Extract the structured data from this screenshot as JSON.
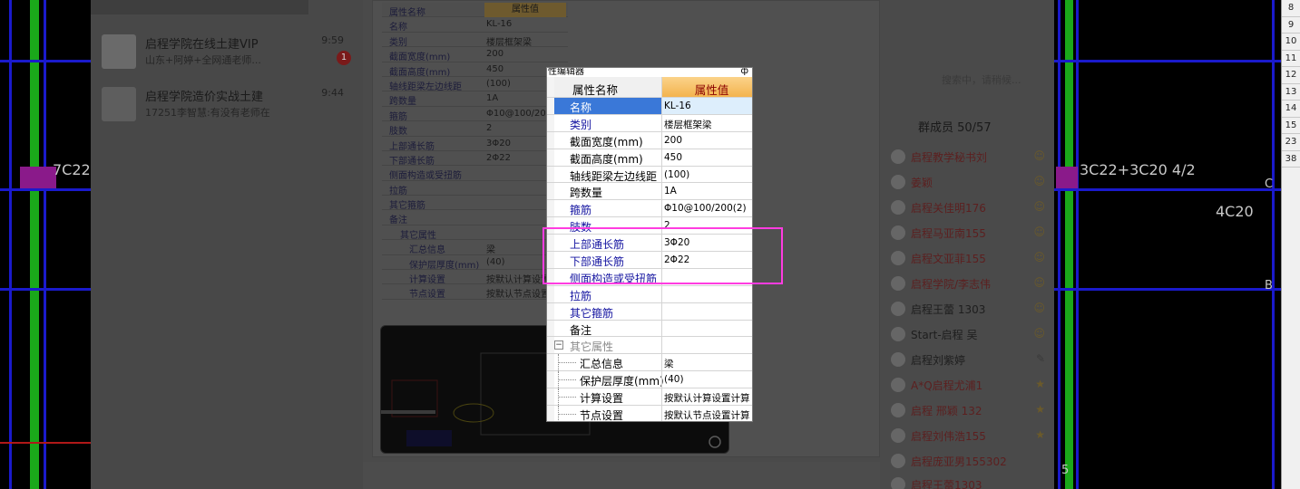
{
  "cad_left": {
    "label": "7C22"
  },
  "cad_right": {
    "label_top": "3C22+3C20 4/2",
    "label_mid": "4C20",
    "marker_c": "C",
    "marker_b": "B",
    "marker_5": "5"
  },
  "ruler": [
    "8",
    "9",
    "10",
    "11",
    "12",
    "13",
    "14",
    "15",
    "23",
    "38"
  ],
  "conversations": [
    {
      "name": "启程学院在线土建VIP",
      "time": "9:59",
      "preview": "山东+阿婷+全网通老师...",
      "badge": "1"
    },
    {
      "name": "启程学院造价实战土建",
      "time": "9:44",
      "preview": "17251李智慧:有没有老师在"
    }
  ],
  "background_table": {
    "header": {
      "key": "属性名称",
      "value": "属性值"
    },
    "rows": [
      {
        "key": "名称",
        "value": "KL-16"
      },
      {
        "key": "类别",
        "value": "楼层框架梁"
      },
      {
        "key": "截面宽度(mm)",
        "value": "200"
      },
      {
        "key": "截面高度(mm)",
        "value": "450"
      },
      {
        "key": "轴线距梁左边线距",
        "value": "(100)"
      },
      {
        "key": "跨数量",
        "value": "1A"
      },
      {
        "key": "箍筋",
        "value": "Φ10@100/200(2)"
      },
      {
        "key": "肢数",
        "value": "2"
      },
      {
        "key": "上部通长筋",
        "value": "3Φ20"
      },
      {
        "key": "下部通长筋",
        "value": "2Φ22"
      },
      {
        "key": "侧面构造或受扭筋",
        "value": ""
      },
      {
        "key": "拉筋",
        "value": ""
      },
      {
        "key": "其它箍筋",
        "value": ""
      },
      {
        "key": "备注",
        "value": ""
      },
      {
        "key": "其它属性",
        "value": ""
      },
      {
        "key": "汇总信息",
        "value": "梁"
      },
      {
        "key": "保护层厚度(mm)",
        "value": "(40)"
      },
      {
        "key": "计算设置",
        "value": "按默认计算设置"
      },
      {
        "key": "节点设置",
        "value": "按默认节点设置"
      }
    ]
  },
  "members": {
    "title": "群成员 50/57",
    "search_hint": "搜索中，请稍候...",
    "list": [
      {
        "name": "启程教学秘书刘",
        "dark": false
      },
      {
        "name": "姜颖",
        "dark": false
      },
      {
        "name": "启程关佳明176",
        "dark": false
      },
      {
        "name": "启程马亚南155",
        "dark": false
      },
      {
        "name": "启程文亚菲155",
        "dark": false
      },
      {
        "name": "启程学院/李志伟",
        "dark": false
      },
      {
        "name": "启程王蕾 1303",
        "dark": true
      },
      {
        "name": "Start-启程 吴",
        "dark": true
      },
      {
        "name": "启程刘紫婷",
        "dark": true
      },
      {
        "name": "A*Q启程尤浦1",
        "dark": false
      },
      {
        "name": "启程 邢颖 132",
        "dark": false
      },
      {
        "name": "启程刘伟浩155",
        "dark": false
      },
      {
        "name": "启程庞亚男155302",
        "dark": false
      },
      {
        "name": "启程王蕾1303",
        "dark": false
      }
    ]
  },
  "editor": {
    "title": "性编辑器",
    "pin": "ф",
    "header": {
      "key": "属性名称",
      "value": "属性值"
    },
    "rows": [
      {
        "key": "名称",
        "value": "KL-16",
        "style": "sel"
      },
      {
        "key": "类别",
        "value": "楼层框架梁",
        "style": "blue"
      },
      {
        "key": "截面宽度(mm)",
        "value": "200",
        "style": ""
      },
      {
        "key": "截面高度(mm)",
        "value": "450",
        "style": ""
      },
      {
        "key": "轴线距梁左边线距",
        "value": "(100)",
        "style": ""
      },
      {
        "key": "跨数量",
        "value": "1A",
        "style": ""
      },
      {
        "key": "箍筋",
        "value": "Φ10@100/200(2)",
        "style": "blue"
      },
      {
        "key": "肢数",
        "value": "2",
        "style": "blue"
      },
      {
        "key": "上部通长筋",
        "value": "3Φ20",
        "style": "blue"
      },
      {
        "key": "下部通长筋",
        "value": "2Φ22",
        "style": "blue"
      },
      {
        "key": "侧面构造或受扭筋",
        "value": "",
        "style": "blue"
      },
      {
        "key": "拉筋",
        "value": "",
        "style": "blue"
      },
      {
        "key": "其它箍筋",
        "value": "",
        "style": "blue"
      },
      {
        "key": "备注",
        "value": "",
        "style": ""
      },
      {
        "key": "其它属性",
        "value": "",
        "style": "group"
      },
      {
        "key": "汇总信息",
        "value": "梁",
        "style": "child"
      },
      {
        "key": "保护层厚度(mm)",
        "value": "(40)",
        "style": "child"
      },
      {
        "key": "计算设置",
        "value": "按默认计算设置计算",
        "style": "child"
      },
      {
        "key": "节点设置",
        "value": "按默认节点设置计算",
        "style": "child"
      }
    ]
  },
  "colors": {
    "highlight": "#ff3ce0",
    "selected_row": "#3a78d8",
    "header_value": "#f3b34e"
  }
}
